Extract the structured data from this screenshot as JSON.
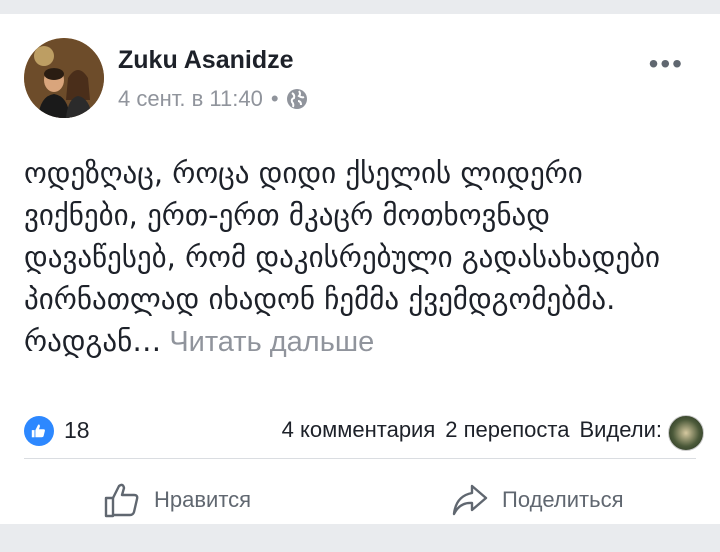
{
  "post": {
    "author": "Zuku Asanidze",
    "date": "4 сент. в 11:40",
    "separator": "•",
    "privacy_icon": "globe-icon",
    "more_icon": "•••",
    "text": "ოდეზღაც, როცა დიდი ქსელის ლიდერი ვიქნები, ერთ-ერთ მკაცრ მოთხოვნად დავაწესებ, რომ დაკისრებული გადასახადები პირნათლად იხადონ ჩემმა ქვემდგომებმა. რადგან",
    "ellipsis": "…",
    "see_more": " Читать дальше"
  },
  "reactions": {
    "like_icon": "thumbs-up-icon",
    "count": "18"
  },
  "stats": {
    "comments": "4 комментария",
    "shares": "2 перепоста",
    "seen": "Видели:"
  },
  "actions": {
    "like_label": "Нравится",
    "share_label": "Поделиться"
  },
  "colors": {
    "accent": "#2d88ff",
    "muted": "#90949c",
    "text": "#1d2129"
  }
}
